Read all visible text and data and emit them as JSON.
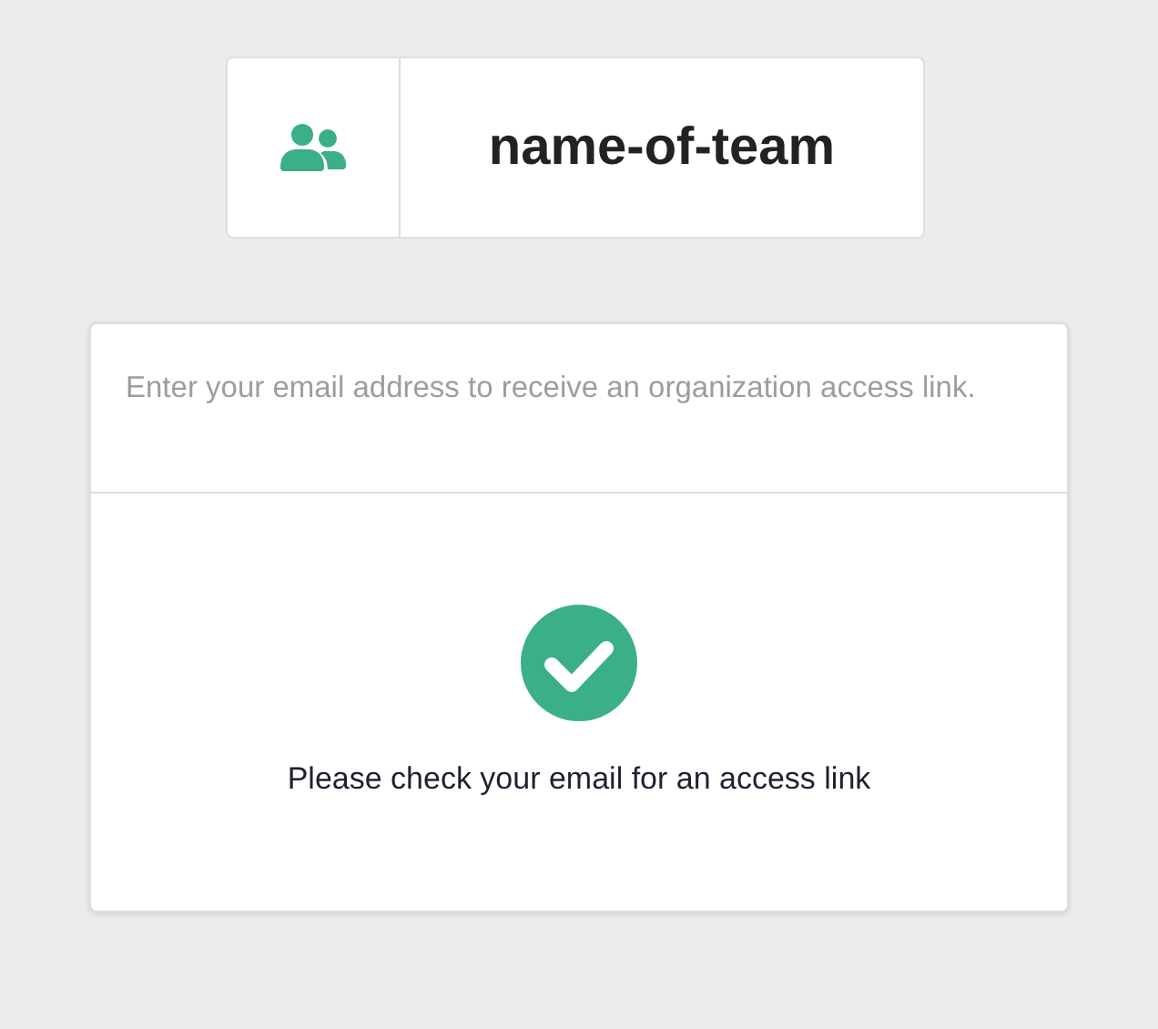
{
  "team": {
    "name": "name-of-team"
  },
  "card": {
    "instructions": "Enter your email address to receive an organization access link.",
    "message": "Please check your email for an access link"
  }
}
